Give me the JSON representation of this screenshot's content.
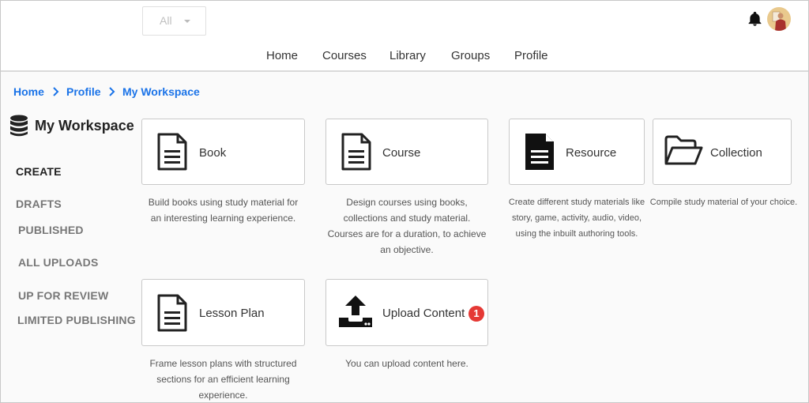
{
  "header": {
    "filter_value": "All",
    "nav": [
      "Home",
      "Courses",
      "Library",
      "Groups",
      "Profile"
    ]
  },
  "breadcrumb": [
    "Home",
    "Profile",
    "My Workspace"
  ],
  "workspace": {
    "title": "My Workspace"
  },
  "sidebar": {
    "items": [
      {
        "label": "CREATE",
        "active": true
      },
      {
        "label": "DRAFTS",
        "active": false
      },
      {
        "label": "PUBLISHED",
        "active": false
      },
      {
        "label": "ALL UPLOADS",
        "active": false
      },
      {
        "label": "UP FOR REVIEW",
        "active": false
      },
      {
        "label": "LIMITED PUBLISHING",
        "active": false
      }
    ]
  },
  "cards": [
    {
      "label": "Book",
      "icon": "document-outline-icon",
      "desc": [
        "Build books using study material for",
        "an interesting learning experience."
      ]
    },
    {
      "label": "Course",
      "icon": "document-outline-icon",
      "desc": [
        "Design courses using books,",
        "collections and study material.",
        "Courses are for a duration, to achieve",
        "an objective."
      ]
    },
    {
      "label": "Resource",
      "icon": "document-filled-icon",
      "desc": [
        "Create different study materials like",
        "story, game, activity, audio, video,",
        "using the inbuilt authoring tools."
      ]
    },
    {
      "label": "Collection",
      "icon": "folder-open-icon",
      "desc": [
        "Compile study material of your choice."
      ]
    },
    {
      "label": "Lesson Plan",
      "icon": "document-outline-icon",
      "desc": [
        "Frame lesson plans with structured",
        "sections for an efficient learning",
        "experience."
      ]
    },
    {
      "label": "Upload Content",
      "icon": "upload-icon",
      "badge": "1",
      "desc": [
        "You can upload content here."
      ]
    }
  ],
  "colors": {
    "link": "#1a73e8",
    "badge": "#e53935"
  }
}
